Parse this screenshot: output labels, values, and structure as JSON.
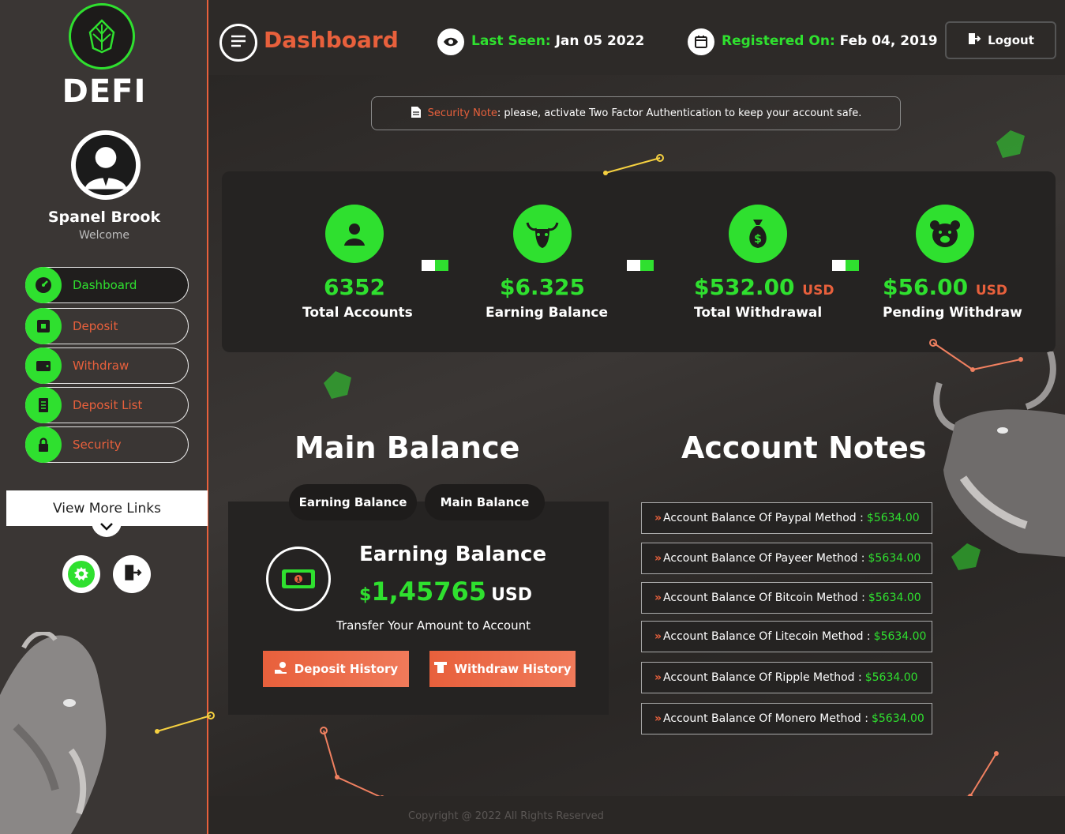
{
  "brand": {
    "logo_text": "DEFI"
  },
  "user": {
    "name": "Spanel Brook",
    "welcome": "Welcome"
  },
  "sidebar": {
    "items": [
      {
        "label": "Dashboard",
        "icon": "speedometer-icon"
      },
      {
        "label": "Deposit",
        "icon": "deposit-icon"
      },
      {
        "label": "Withdraw",
        "icon": "wallet-icon"
      },
      {
        "label": "Deposit List",
        "icon": "list-icon"
      },
      {
        "label": "Security",
        "icon": "lock-icon"
      }
    ],
    "view_more": "View More Links"
  },
  "header": {
    "title": "Dashboard",
    "last_seen_label": "Last Seen:",
    "last_seen_value": "Jan 05 2022",
    "registered_label": "Registered On:",
    "registered_value": "Feb 04, 2019",
    "logout": "Logout"
  },
  "security_note": {
    "label": "Security Note",
    "text": ": please, activate Two Factor Authentication to keep your account safe."
  },
  "stats": [
    {
      "value": "6352",
      "unit": "",
      "label": "Total Accounts",
      "icon": "user-icon"
    },
    {
      "value": "$6.325",
      "unit": "",
      "label": "Earning Balance",
      "icon": "bull-icon"
    },
    {
      "value": "$532.00",
      "unit": "USD",
      "label": "Total Withdrawal",
      "icon": "money-bag-icon"
    },
    {
      "value": "$56.00",
      "unit": "USD",
      "label": "Pending Withdraw",
      "icon": "bear-icon"
    }
  ],
  "main_balance": {
    "title": "Main Balance",
    "tabs": [
      "Earning Balance",
      "Main Balance"
    ],
    "card_title": "Earning Balance",
    "currency_symbol": "$",
    "amount": "1,45765",
    "currency": "USD",
    "transfer_text": "Transfer Your Amount  to  Account",
    "deposit_history": "Deposit History",
    "withdraw_history": "Withdraw History"
  },
  "account_notes": {
    "title": "Account Notes",
    "rows": [
      {
        "label": "Account Balance Of Paypal Method :",
        "amount": "$5634.00"
      },
      {
        "label": "Account Balance Of Payeer Method :",
        "amount": "$5634.00"
      },
      {
        "label": "Account Balance Of Bitcoin Method :",
        "amount": "$5634.00"
      },
      {
        "label": "Account Balance Of Litecoin Method :",
        "amount": "$5634.00"
      },
      {
        "label": "Account Balance Of Ripple Method :",
        "amount": "$5634.00"
      },
      {
        "label": "Account Balance Of Monero Method :",
        "amount": "$5634.00"
      }
    ]
  },
  "footer": {
    "copyright": "Copyright @ 2022 All Rights Reserved"
  },
  "colors": {
    "accent_green": "#2fe02f",
    "accent_orange": "#e8603c",
    "background": "#2f2b29"
  }
}
